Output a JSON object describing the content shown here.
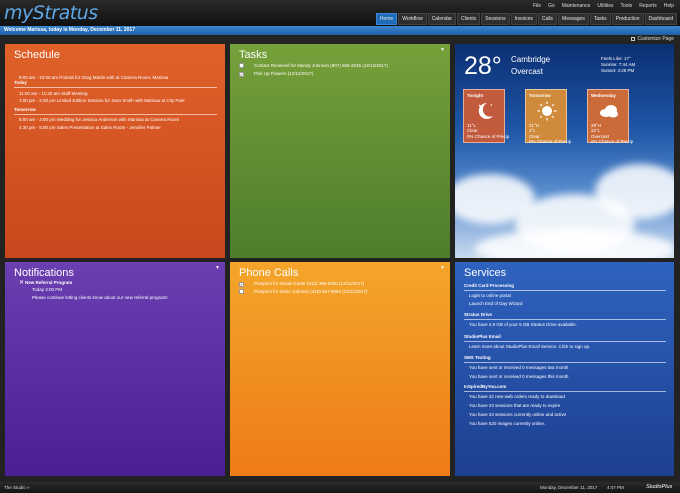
{
  "app": {
    "logo": "myStratus"
  },
  "menus": [
    "File",
    "Go",
    "Maintenance",
    "Utilities",
    "Tools",
    "Reports",
    "Help"
  ],
  "navtabs": [
    "Home",
    "Workflow",
    "Calendar",
    "Clients",
    "Sessions",
    "Invoices",
    "Calls",
    "Messages",
    "Tasks",
    "Production",
    "Dashboard"
  ],
  "welcome": "Welcome Marissa, today is Monday, December 11, 2017",
  "customize": "Customize Page",
  "schedule": {
    "title": "Schedule",
    "today_label": "Today",
    "today_items": [
      "9:00 am - 10:00 am  Portrait for Greg Martin with  at Camera Room: Marissa",
      "11:00 am - 11:30 am  Staff Meeting",
      "1:00 pm - 2:30 pm  Limited Edition Session for Jean Smith with Marissa at City Park"
    ],
    "tomorrow_label": "Tomorrow",
    "tomorrow_items": [
      "8:00 am - 3:00 pm  Wedding for Jessica Anderson with Marissa at Camera Room",
      "4:30 pm - 5:00 pm  Sales Presentation at Sales Room - Jennifer Palmer"
    ]
  },
  "tasks": {
    "title": "Tasks",
    "items": [
      {
        "label": "Contact Received for Mandy Johnson (907) 555-2045 (12/12/2017)",
        "checked": false
      },
      {
        "label": "Pick Up Flowers (12/12/2017)",
        "checked": true
      }
    ]
  },
  "weather": {
    "temp": "28°",
    "city": "Cambridge",
    "condition": "Overcast",
    "feels_like": "Feels Like: 17°",
    "sunrise": "Sunrise: 7:44 AM",
    "sunset": "Sunset: 4:29 PM",
    "forecast": [
      {
        "label": "Tonight",
        "line1": "11°L",
        "line2": "Clear",
        "line3": "0% Chance of Precip",
        "color": "#c25b3d",
        "icon": "moon-icon"
      },
      {
        "label": "Tomorrow",
        "line1": "21°H",
        "line2": "2°L",
        "line3": "Clear",
        "line4": "0% Chance of Precip",
        "color": "#cf8a3c",
        "icon": "sun-icon"
      },
      {
        "label": "Wednesday",
        "line1": "28°H",
        "line2": "22°L",
        "line3": "Overcast",
        "line4": "0% Chance of Precip",
        "color": "#cc6b3a",
        "icon": "cloud-icon"
      }
    ]
  },
  "notifications": {
    "title": "Notifications",
    "item_title": "New Referral Program",
    "item_time": "Today 3:00 PM",
    "item_body": "Please continue letting clients know about our new referral program!"
  },
  "phone_calls": {
    "title": "Phone Calls",
    "items": [
      {
        "label": "Prospect for Nicole Carter (612) 386-0000 (12/11/2017)",
        "checked": true
      },
      {
        "label": "Prospect for Kevin Johnson (418) 567-8054 (12/11/2017)",
        "checked": false
      }
    ]
  },
  "services": {
    "title": "Services",
    "sections": [
      {
        "head": "Credit Card Processing",
        "items": [
          "Login to online portal",
          "Launch End of Day Wizard"
        ]
      },
      {
        "head": "Stratus Drive",
        "items": [
          "You have 4.9 GB of your 5 GB Stratus Drive available."
        ]
      },
      {
        "head": "StudioPlus Email",
        "items": [
          "Learn more about StudioPlus Email Service.   Click to sign up."
        ]
      },
      {
        "head": "SMS Texting",
        "items": [
          "You have sent or received 0 messages last month",
          "You have sent or received 0 messages this month"
        ]
      },
      {
        "head": "InSpiredByYou.com",
        "items": [
          "You have 22 new web orders ready to download",
          "You have 23 sessions that are ready to expire",
          "You have 24 sessions currently online and active",
          "You have 520 images currently online."
        ]
      }
    ]
  },
  "footer": {
    "studio": "The Studio",
    "date": "Monday, December 11, 2017",
    "time": "4:47 PM",
    "brand": "StudioPlus"
  }
}
